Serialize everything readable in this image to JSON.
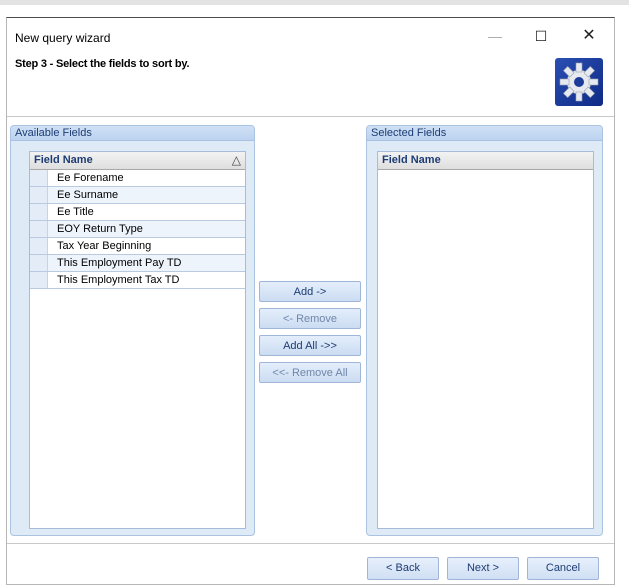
{
  "window": {
    "title": "New query wizard",
    "minimize_icon": "minimize-icon",
    "maximize_icon": "maximize-icon",
    "close_icon": "close-icon"
  },
  "header": {
    "step_text": "Step 3 - Select the fields to sort by.",
    "gear_icon": "gear-icon"
  },
  "available": {
    "title": "Available Fields",
    "column_header": "Field Name",
    "sort_icon": "sort-ascending-icon",
    "rows": [
      "Ee Forename",
      "Ee Surname",
      "Ee Title",
      "EOY Return Type",
      "Tax Year Beginning",
      "This Employment Pay TD",
      "This Employment Tax TD"
    ]
  },
  "actions": {
    "add": "Add ->",
    "remove": "<- Remove",
    "add_all": "Add All ->>",
    "remove_all": "<<- Remove All"
  },
  "selected": {
    "title": "Selected Fields",
    "column_header": "Field Name"
  },
  "footer": {
    "back": "< Back",
    "next": "Next >",
    "cancel": "Cancel"
  },
  "colors": {
    "panel_bg": "#dfeaf7",
    "accent": "#1d3c73",
    "gear_blue": "#1d3c9a"
  }
}
